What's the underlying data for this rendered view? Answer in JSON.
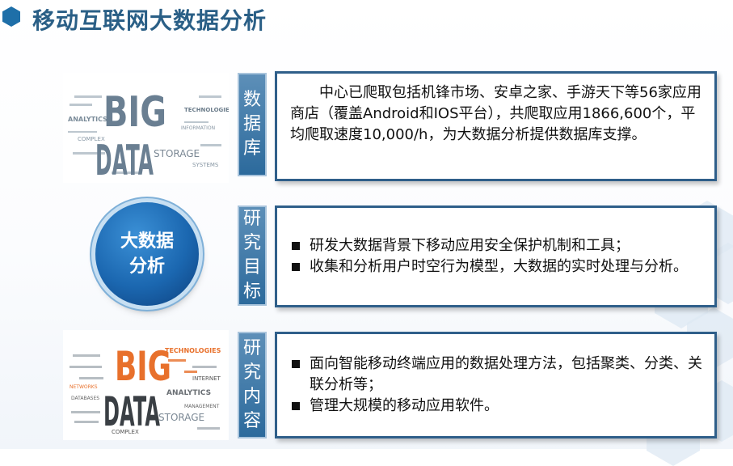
{
  "title": "移动互联网大数据分析",
  "center_circle": {
    "line1": "大数据",
    "line2": "分析"
  },
  "sections": [
    {
      "label": [
        "数",
        "据",
        "库"
      ],
      "paragraph": "中心已爬取包括机锋市场、安卓之家、手游天下等56家应用商店（覆盖Android和IOS平台），共爬取应用1866,600个，平均爬取速度10,000/h，为大数据分析提供数据库支撑。"
    },
    {
      "label": [
        "研",
        "究",
        "目",
        "标"
      ],
      "bullets": [
        "研发大数据背景下移动应用安全保护机制和工具；",
        "收集和分析用户时空行为模型，大数据的实时处理与分析。"
      ]
    },
    {
      "label": [
        "研",
        "究",
        "内",
        "容"
      ],
      "bullets": [
        "面向智能移动终端应用的数据处理方法，包括聚类、分类、关联分析等；",
        "管理大规模的移动应用软件。"
      ]
    }
  ],
  "word_clouds": [
    {
      "main_top": "BIG",
      "main_bottom": "DATA",
      "words": [
        "ANALYTICS",
        "TECHNOLOGIES",
        "STORAGE",
        "COMPLEX",
        "INFORMATION",
        "SYSTEMS"
      ]
    },
    {
      "main_top": "BIG",
      "main_bottom": "DATA",
      "words": [
        "TECHNOLOGIES",
        "ANALYTICS",
        "STORAGE",
        "INTERNET",
        "COMPLEX",
        "DATABASES",
        "NETWORKS",
        "MANAGEMENT"
      ]
    }
  ],
  "colors": {
    "title": "#2a5f86",
    "label_bg": "#2c6a9c",
    "box_border": "#2f5f8a",
    "circle": "#1b67b0",
    "cloud1_main": "#6a7f92",
    "cloud2_main": "#e8702b"
  }
}
